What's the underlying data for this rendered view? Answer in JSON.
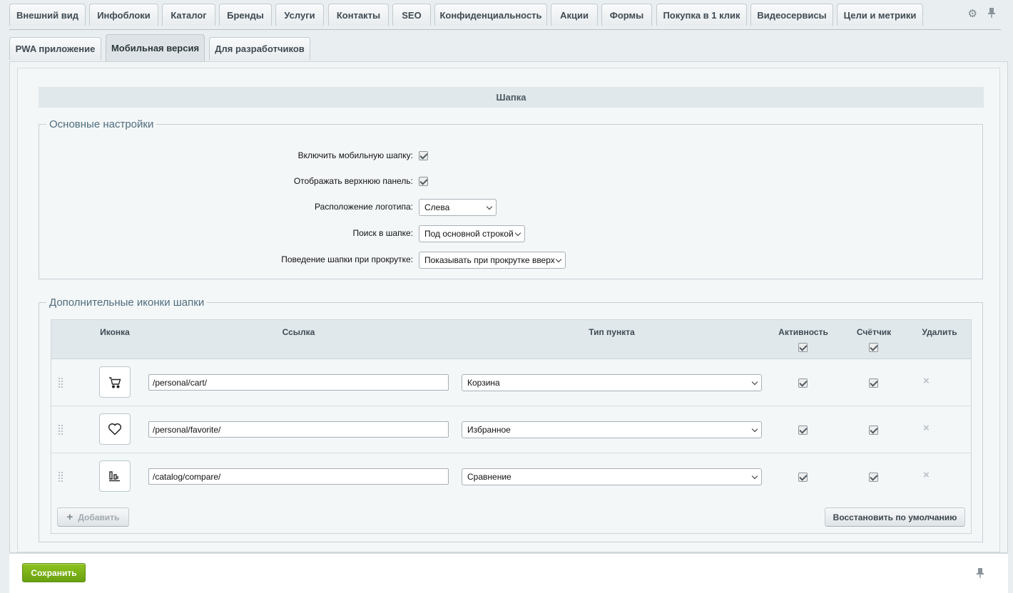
{
  "top_tabs": [
    {
      "label": "Внешний вид"
    },
    {
      "label": "Инфоблоки"
    },
    {
      "label": "Каталог"
    },
    {
      "label": "Бренды"
    },
    {
      "label": "Услуги"
    },
    {
      "label": "Контакты"
    },
    {
      "label": "SEO"
    },
    {
      "label": "Конфиденциальность"
    },
    {
      "label": "Акции"
    },
    {
      "label": "Формы"
    },
    {
      "label": "Покупка в 1 клик"
    },
    {
      "label": "Видеосервисы"
    },
    {
      "label": "Цели и метрики"
    }
  ],
  "sub_tabs": [
    {
      "label": "PWA приложение"
    },
    {
      "label": "Мобильная версия",
      "active": true
    },
    {
      "label": "Для разработчиков"
    }
  ],
  "section": {
    "title": "Шапка"
  },
  "basic": {
    "legend": "Основные настройки",
    "enable_mobile_header": {
      "label": "Включить мобильную шапку:",
      "checked": true
    },
    "show_top_panel": {
      "label": "Отображать верхнюю панель:",
      "checked": true
    },
    "logo_position": {
      "label": "Расположение логотипа:",
      "value": "Слева"
    },
    "search": {
      "label": "Поиск в шапке:",
      "value": "Под основной строкой"
    },
    "scroll_behavior": {
      "label": "Поведение шапки при прокрутке:",
      "value": "Показывать при прокрутке вверх"
    }
  },
  "extra": {
    "legend": "Дополнительные иконки шапки",
    "columns": {
      "icon": "Иконка",
      "link": "Ссылка",
      "type": "Тип пункта",
      "active": "Активность",
      "counter": "Счётчик",
      "delete": "Удалить"
    },
    "rows": [
      {
        "icon": "cart-icon",
        "link": "/personal/cart/",
        "type": "Корзина",
        "active": true,
        "counter": true
      },
      {
        "icon": "heart-icon",
        "link": "/personal/favorite/",
        "type": "Избранное",
        "active": true,
        "counter": true
      },
      {
        "icon": "compare-icon",
        "link": "/catalog/compare/",
        "type": "Сравнение",
        "active": true,
        "counter": true
      }
    ],
    "add_label": "Добавить",
    "restore_label": "Восстановить по умолчанию"
  },
  "footer": {
    "save_label": "Сохранить"
  },
  "colors": {
    "accent_green": "#7ab317",
    "header_bg": "#e0e8eb"
  }
}
